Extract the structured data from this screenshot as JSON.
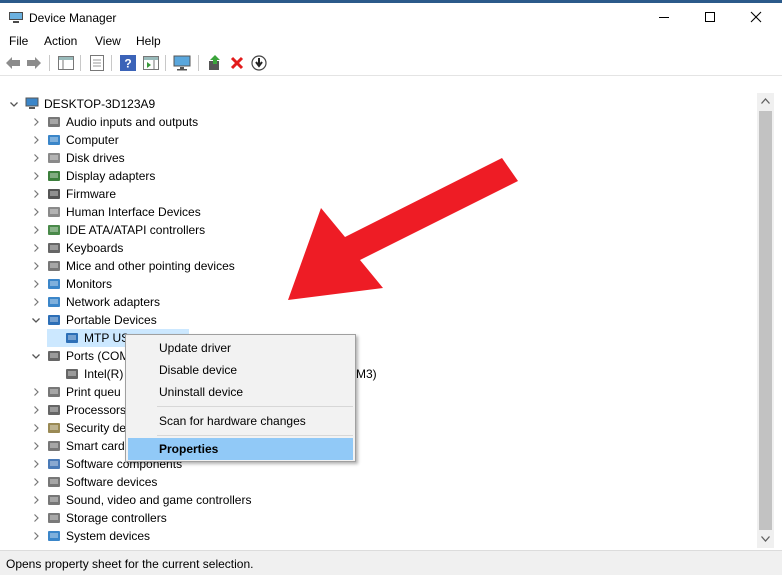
{
  "window": {
    "title": "Device Manager"
  },
  "menu": [
    "File",
    "Action",
    "View",
    "Help"
  ],
  "tree": {
    "root": "DESKTOP-3D123A9",
    "items": [
      {
        "label": "Audio inputs and outputs",
        "icon": "speaker-icon"
      },
      {
        "label": "Computer",
        "icon": "computer-icon"
      },
      {
        "label": "Disk drives",
        "icon": "disk-drive-icon"
      },
      {
        "label": "Display adapters",
        "icon": "display-adapter-icon"
      },
      {
        "label": "Firmware",
        "icon": "firmware-icon"
      },
      {
        "label": "Human Interface Devices",
        "icon": "hid-icon"
      },
      {
        "label": "IDE ATA/ATAPI controllers",
        "icon": "ide-controller-icon"
      },
      {
        "label": "Keyboards",
        "icon": "keyboard-icon"
      },
      {
        "label": "Mice and other pointing devices",
        "icon": "mouse-icon"
      },
      {
        "label": "Monitors",
        "icon": "monitor-icon"
      },
      {
        "label": "Network adapters",
        "icon": "network-adapter-icon"
      },
      {
        "label": "Portable Devices",
        "icon": "portable-device-icon"
      },
      {
        "label": "MTP US",
        "icon": "portable-device-icon"
      },
      {
        "label": "Ports (COM",
        "icon": "port-icon"
      },
      {
        "label": "Intel(R)",
        "icon": "port-icon"
      },
      {
        "label": "Print queu",
        "icon": "printer-icon"
      },
      {
        "label": "Processors",
        "icon": "processor-icon"
      },
      {
        "label": "Security de",
        "icon": "security-device-icon"
      },
      {
        "label": "Smart card",
        "icon": "smart-card-icon"
      },
      {
        "label": "Software components",
        "icon": "software-component-icon"
      },
      {
        "label": "Software devices",
        "icon": "software-device-icon"
      },
      {
        "label": "Sound, video and game controllers",
        "icon": "sound-icon"
      },
      {
        "label": "Storage controllers",
        "icon": "storage-controller-icon"
      },
      {
        "label": "System devices",
        "icon": "system-device-icon"
      }
    ],
    "partial_text": "M3)"
  },
  "context_menu": {
    "items": [
      "Update driver",
      "Disable device",
      "Uninstall device",
      "Scan for hardware changes",
      "Properties"
    ],
    "highlighted": "Properties"
  },
  "status": "Opens property sheet for the current selection.",
  "colors": {
    "highlight": "#91c9f7",
    "selection": "#cce8ff",
    "annotation_arrow": "#ee1c25",
    "title_border": "#2b5a8a"
  }
}
